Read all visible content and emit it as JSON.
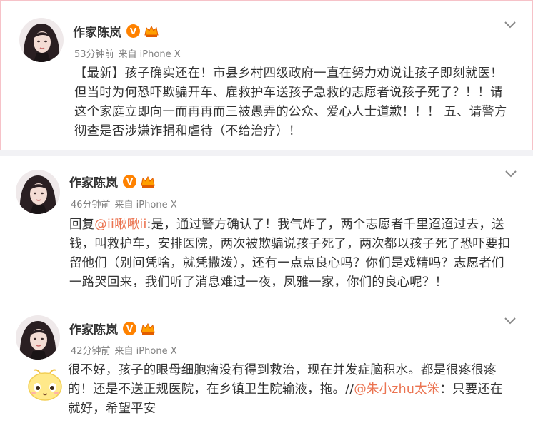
{
  "colors": {
    "link": "#eb7350",
    "verified_badge": "#ff8200",
    "meta_text": "#808080",
    "pinned_border": "#f6c2c8"
  },
  "posts": [
    {
      "author": "作家陈岚",
      "badge_icon": "verified-v-badge",
      "member_icon": "crown-member-icon",
      "time": "53分钟前",
      "source": "来自 iPhone X",
      "text": "【最新】孩子确实还在！市县乡村四级政府一直在努力劝说让孩子即刻就医！但当时为何恐吓欺骗开车、雇救护车送孩子急救的志愿者说孩子死了？！！请这个家庭立即向一而再再而三被愚弄的公众、爱心人士道歉！！！ 五、请警方彻查是否涉嫌诈捐和虐待（不给治疗）！"
    },
    {
      "author": "作家陈岚",
      "badge_icon": "verified-v-badge",
      "member_icon": "crown-member-icon",
      "time": "46分钟前",
      "source": "来自 iPhone X",
      "reply_prefix": "回复",
      "mention": "@ii啾啾ii",
      "text": ":是，通过警方确认了！我气炸了，两个志愿者千里迢迢过去，送钱，叫救护车，安排医院，两次被欺骗说孩子死了，两次都以孩子死了恐吓要扣留他们（别问凭啥，就凭撒泼），还有一点点良心吗？你们是戏精吗？志愿者们一路哭回来，我们听了消息难过一夜，凤雅一家，你们的良心呢？！"
    },
    {
      "author": "作家陈岚",
      "badge_icon": "verified-v-badge",
      "member_icon": "crown-member-icon",
      "time": "42分钟前",
      "source": "来自 iPhone X",
      "emoji_icon": "cute-face-emoji",
      "text_before": "很不好，孩子的眼母细胞瘤没有得到救治，现在并发症脑积水。都是很疼很疼的！还是不送正规医院，在乡镇卫生院输液，拖。//",
      "mention": "@朱小zhu太笨",
      "text_after": "：只要还在就好，希望平安"
    }
  ]
}
